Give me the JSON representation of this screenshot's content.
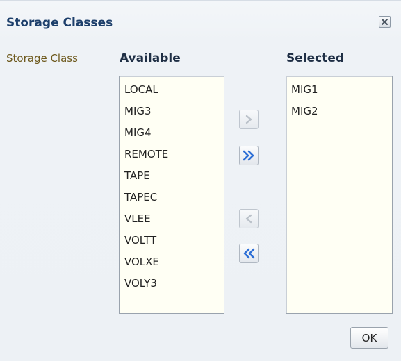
{
  "dialog": {
    "title": "Storage Classes",
    "close_icon": "close-icon"
  },
  "field_label": "Storage Class",
  "available": {
    "header": "Available",
    "items": [
      "LOCAL",
      "MIG3",
      "MIG4",
      "REMOTE",
      "TAPE",
      "TAPEC",
      "VLEE",
      "VOLTT",
      "VOLXE",
      "VOLY3"
    ]
  },
  "selected": {
    "header": "Selected",
    "items": [
      "MIG1",
      "MIG2"
    ]
  },
  "shuttle": {
    "move_icon": "chevron-right-icon",
    "move_all_icon": "double-chevron-right-icon",
    "remove_icon": "chevron-left-icon",
    "remove_all_icon": "double-chevron-left-icon"
  },
  "ok_label": "OK",
  "colors": {
    "title": "#1d3f6b",
    "label": "#6e5a1e",
    "list_bg": "#fffff4",
    "active_arrow": "#2e6fd6",
    "disabled_arrow": "#a9b1bb"
  }
}
